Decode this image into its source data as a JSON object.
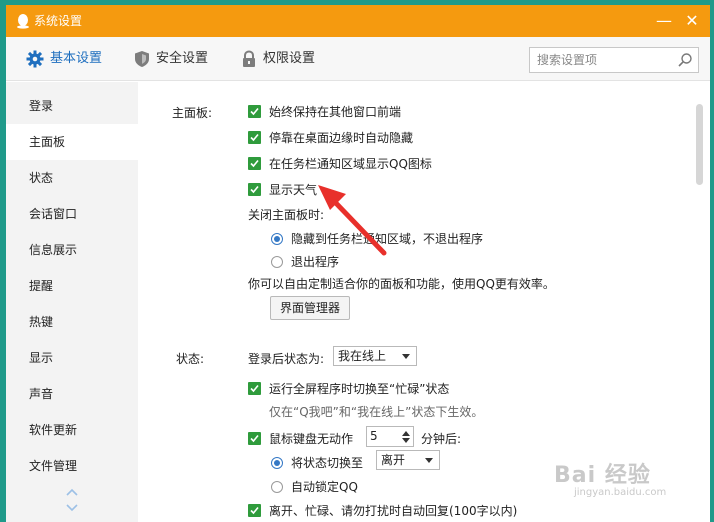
{
  "window": {
    "title": "系统设置",
    "minimize_glyph": "—",
    "close_glyph": "✕"
  },
  "toolbar": {
    "tabs": [
      {
        "label": "基本设置",
        "icon": "gear-icon"
      },
      {
        "label": "安全设置",
        "icon": "shield-icon"
      },
      {
        "label": "权限设置",
        "icon": "lock-icon"
      }
    ],
    "search": {
      "placeholder": "搜索设置项",
      "value": ""
    }
  },
  "sidebar": {
    "items": [
      {
        "label": "登录"
      },
      {
        "label": "主面板"
      },
      {
        "label": "状态"
      },
      {
        "label": "会话窗口"
      },
      {
        "label": "信息展示"
      },
      {
        "label": "提醒"
      },
      {
        "label": "热键"
      },
      {
        "label": "显示"
      },
      {
        "label": "声音"
      },
      {
        "label": "软件更新"
      },
      {
        "label": "文件管理"
      }
    ],
    "active_index": 1
  },
  "main_panel": {
    "label": "主面板:",
    "options": [
      {
        "label": "始终保持在其他窗口前端",
        "checked": true
      },
      {
        "label": "停靠在桌面边缘时自动隐藏",
        "checked": true
      },
      {
        "label": "在任务栏通知区域显示QQ图标",
        "checked": true
      },
      {
        "label": "显示天气",
        "checked": true
      }
    ],
    "close_label": "关闭主面板时:",
    "close_options": [
      {
        "label": "隐藏到任务栏通知区域，不退出程序",
        "selected": true
      },
      {
        "label": "退出程序",
        "selected": false
      }
    ],
    "customize_text": "你可以自由定制适合你的面板和功能，使用QQ更有效率。",
    "manager_button": "界面管理器"
  },
  "status": {
    "label": "状态:",
    "login_status_label": "登录后状态为:",
    "login_status_value": "我在线上",
    "fullscreen_busy": {
      "label": "运行全屏程序时切换至“忙碌”状态",
      "checked": true
    },
    "fullscreen_hint": "仅在“Q我吧”和“我在线上”状态下生效。",
    "idle": {
      "label": "鼠标键盘无动作",
      "checked": true,
      "minutes": "5",
      "suffix": "分钟后:"
    },
    "idle_options": [
      {
        "label": "将状态切换至",
        "selected": true
      },
      {
        "label": "自动锁定QQ",
        "selected": false
      }
    ],
    "idle_status_value": "离开",
    "auto_reply": {
      "label": "离开、忙碌、请勿打扰时自动回复(100字以内)",
      "checked": true
    }
  },
  "watermark": {
    "main": "Bai 经验",
    "sub": "jingyan.baidu.com"
  },
  "colors": {
    "titlebar": "#f59a0f",
    "accent": "#1f6fbf",
    "checkbox": "#2f9b3c",
    "arrow": "#e8302b"
  }
}
